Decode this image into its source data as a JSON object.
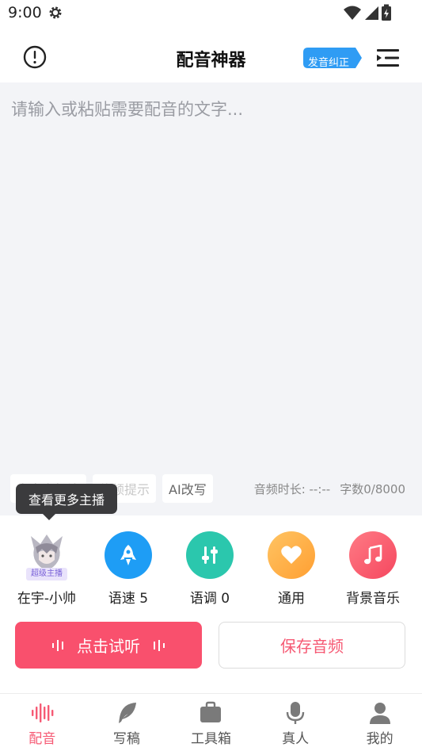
{
  "status_bar": {
    "time": "9:00"
  },
  "header": {
    "title": "配音神器",
    "pronunciation_label": "发音纠正"
  },
  "editor": {
    "placeholder": "请输入或粘贴需要配音的文字...",
    "chips": [
      {
        "label": "多音字标注"
      },
      {
        "label": "停顿提示"
      },
      {
        "label": "AI改写"
      }
    ],
    "duration_label": "音频时长: --:--",
    "word_count_label": "字数0/8000"
  },
  "tooltip": {
    "text": "查看更多主播"
  },
  "controls": {
    "anchor": {
      "name": "在宇-小帅",
      "badge": "超级主播"
    },
    "speed": {
      "label": "语速 5",
      "color": "#1e9df5"
    },
    "pitch": {
      "label": "语调 0",
      "color": "#2bc7ad"
    },
    "style": {
      "label": "通用",
      "color": "#ffad42"
    },
    "bgm": {
      "label": "背景音乐",
      "color": "#f95a6c"
    }
  },
  "actions": {
    "listen_label": "点击试听",
    "save_label": "保存音频"
  },
  "bottom_nav": {
    "items": [
      {
        "label": "配音",
        "icon": "waveform-icon"
      },
      {
        "label": "写稿",
        "icon": "feather-icon"
      },
      {
        "label": "工具箱",
        "icon": "toolbox-icon"
      },
      {
        "label": "真人",
        "icon": "microphone-icon"
      },
      {
        "label": "我的",
        "icon": "person-icon"
      }
    ],
    "active_color": "#f65a74"
  }
}
